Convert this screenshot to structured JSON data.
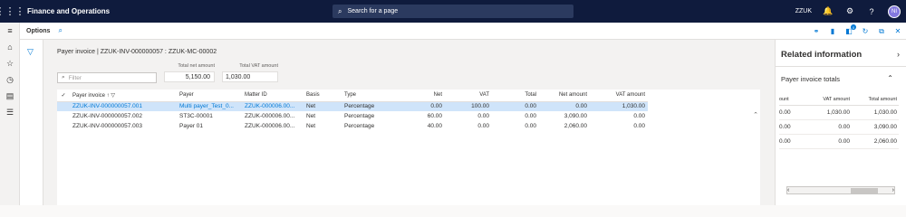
{
  "topbar": {
    "waffle_icon": "⋮⋮⋮",
    "app_title": "Finance and Operations",
    "search_placeholder": "Search for a page",
    "company": "ZZUK",
    "notifications_count": "",
    "avatar_initials": "NI"
  },
  "actionbar": {
    "options_label": "Options"
  },
  "page": {
    "caption": "Payer invoice  |  ZZUK-INV-000000057 : ZZUK-MC-00002",
    "total_net_label": "Total net amount",
    "total_net_value": "5,150.00",
    "total_vat_label": "Total VAT amount",
    "total_vat_value": "1,030.00",
    "filter_placeholder": "Filter"
  },
  "grid": {
    "columns": [
      "Payer invoice ↑",
      "Payer",
      "Matter ID",
      "Basis",
      "Type",
      "Net",
      "VAT",
      "Total",
      "Net amount",
      "VAT amount"
    ],
    "rows": [
      {
        "invoice": "ZZUK-INV-000000057.001",
        "payer": "Multi payer_Test_0...",
        "matter": "ZZUK-000006.00...",
        "basis": "Net",
        "type": "Percentage",
        "net": "0.00",
        "vat": "100.00",
        "total": "0.00",
        "net_amount": "0.00",
        "vat_amount": "1,030.00"
      },
      {
        "invoice": "ZZUK-INV-000000057.002",
        "payer": "ST3C-00001",
        "matter": "ZZUK-000006.00...",
        "basis": "Net",
        "type": "Percentage",
        "net": "60.00",
        "vat": "0.00",
        "total": "0.00",
        "net_amount": "3,090.00",
        "vat_amount": "0.00"
      },
      {
        "invoice": "ZZUK-INV-000000057.003",
        "payer": "Payer 01",
        "matter": "ZZUK-000006.00...",
        "basis": "Net",
        "type": "Percentage",
        "net": "40.00",
        "vat": "0.00",
        "total": "0.00",
        "net_amount": "2,060.00",
        "vat_amount": "0.00"
      }
    ]
  },
  "related": {
    "title": "Related information",
    "section": "Payer invoice totals",
    "columns": [
      "ount",
      "VAT amount",
      "Total amount"
    ],
    "rows": [
      [
        "0.00",
        "1,030.00",
        "1,030.00"
      ],
      [
        "0.00",
        "0.00",
        "3,090.00"
      ],
      [
        "0.00",
        "0.00",
        "2,060.00"
      ]
    ]
  }
}
